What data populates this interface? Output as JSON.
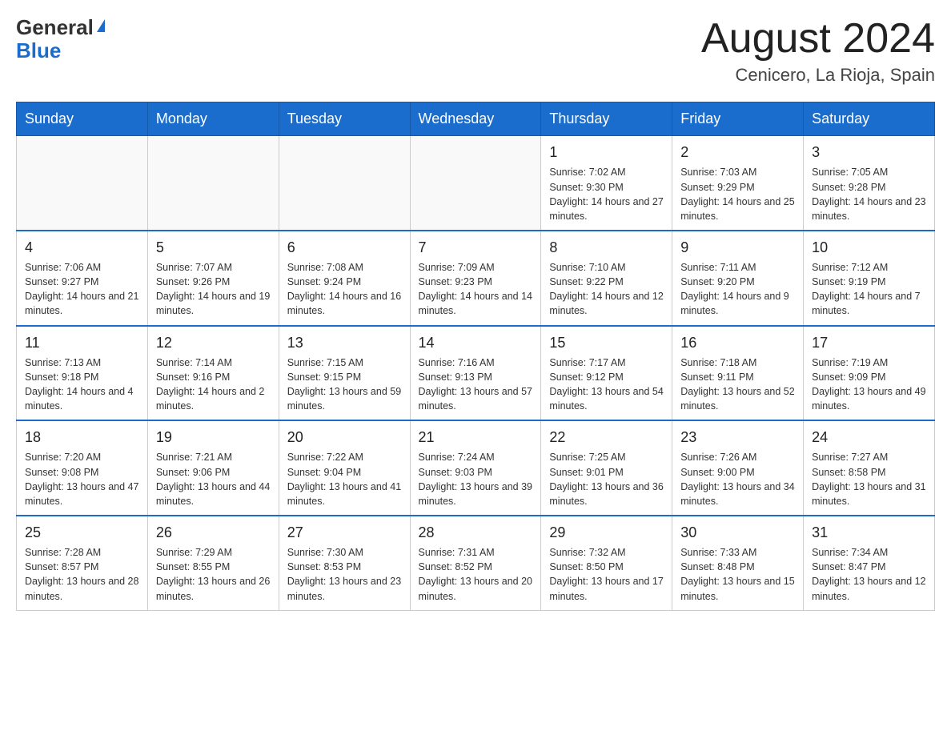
{
  "header": {
    "logo_general": "General",
    "logo_blue": "Blue",
    "month_title": "August 2024",
    "location": "Cenicero, La Rioja, Spain"
  },
  "days_of_week": [
    "Sunday",
    "Monday",
    "Tuesday",
    "Wednesday",
    "Thursday",
    "Friday",
    "Saturday"
  ],
  "weeks": [
    [
      {
        "day": "",
        "info": ""
      },
      {
        "day": "",
        "info": ""
      },
      {
        "day": "",
        "info": ""
      },
      {
        "day": "",
        "info": ""
      },
      {
        "day": "1",
        "info": "Sunrise: 7:02 AM\nSunset: 9:30 PM\nDaylight: 14 hours and 27 minutes."
      },
      {
        "day": "2",
        "info": "Sunrise: 7:03 AM\nSunset: 9:29 PM\nDaylight: 14 hours and 25 minutes."
      },
      {
        "day": "3",
        "info": "Sunrise: 7:05 AM\nSunset: 9:28 PM\nDaylight: 14 hours and 23 minutes."
      }
    ],
    [
      {
        "day": "4",
        "info": "Sunrise: 7:06 AM\nSunset: 9:27 PM\nDaylight: 14 hours and 21 minutes."
      },
      {
        "day": "5",
        "info": "Sunrise: 7:07 AM\nSunset: 9:26 PM\nDaylight: 14 hours and 19 minutes."
      },
      {
        "day": "6",
        "info": "Sunrise: 7:08 AM\nSunset: 9:24 PM\nDaylight: 14 hours and 16 minutes."
      },
      {
        "day": "7",
        "info": "Sunrise: 7:09 AM\nSunset: 9:23 PM\nDaylight: 14 hours and 14 minutes."
      },
      {
        "day": "8",
        "info": "Sunrise: 7:10 AM\nSunset: 9:22 PM\nDaylight: 14 hours and 12 minutes."
      },
      {
        "day": "9",
        "info": "Sunrise: 7:11 AM\nSunset: 9:20 PM\nDaylight: 14 hours and 9 minutes."
      },
      {
        "day": "10",
        "info": "Sunrise: 7:12 AM\nSunset: 9:19 PM\nDaylight: 14 hours and 7 minutes."
      }
    ],
    [
      {
        "day": "11",
        "info": "Sunrise: 7:13 AM\nSunset: 9:18 PM\nDaylight: 14 hours and 4 minutes."
      },
      {
        "day": "12",
        "info": "Sunrise: 7:14 AM\nSunset: 9:16 PM\nDaylight: 14 hours and 2 minutes."
      },
      {
        "day": "13",
        "info": "Sunrise: 7:15 AM\nSunset: 9:15 PM\nDaylight: 13 hours and 59 minutes."
      },
      {
        "day": "14",
        "info": "Sunrise: 7:16 AM\nSunset: 9:13 PM\nDaylight: 13 hours and 57 minutes."
      },
      {
        "day": "15",
        "info": "Sunrise: 7:17 AM\nSunset: 9:12 PM\nDaylight: 13 hours and 54 minutes."
      },
      {
        "day": "16",
        "info": "Sunrise: 7:18 AM\nSunset: 9:11 PM\nDaylight: 13 hours and 52 minutes."
      },
      {
        "day": "17",
        "info": "Sunrise: 7:19 AM\nSunset: 9:09 PM\nDaylight: 13 hours and 49 minutes."
      }
    ],
    [
      {
        "day": "18",
        "info": "Sunrise: 7:20 AM\nSunset: 9:08 PM\nDaylight: 13 hours and 47 minutes."
      },
      {
        "day": "19",
        "info": "Sunrise: 7:21 AM\nSunset: 9:06 PM\nDaylight: 13 hours and 44 minutes."
      },
      {
        "day": "20",
        "info": "Sunrise: 7:22 AM\nSunset: 9:04 PM\nDaylight: 13 hours and 41 minutes."
      },
      {
        "day": "21",
        "info": "Sunrise: 7:24 AM\nSunset: 9:03 PM\nDaylight: 13 hours and 39 minutes."
      },
      {
        "day": "22",
        "info": "Sunrise: 7:25 AM\nSunset: 9:01 PM\nDaylight: 13 hours and 36 minutes."
      },
      {
        "day": "23",
        "info": "Sunrise: 7:26 AM\nSunset: 9:00 PM\nDaylight: 13 hours and 34 minutes."
      },
      {
        "day": "24",
        "info": "Sunrise: 7:27 AM\nSunset: 8:58 PM\nDaylight: 13 hours and 31 minutes."
      }
    ],
    [
      {
        "day": "25",
        "info": "Sunrise: 7:28 AM\nSunset: 8:57 PM\nDaylight: 13 hours and 28 minutes."
      },
      {
        "day": "26",
        "info": "Sunrise: 7:29 AM\nSunset: 8:55 PM\nDaylight: 13 hours and 26 minutes."
      },
      {
        "day": "27",
        "info": "Sunrise: 7:30 AM\nSunset: 8:53 PM\nDaylight: 13 hours and 23 minutes."
      },
      {
        "day": "28",
        "info": "Sunrise: 7:31 AM\nSunset: 8:52 PM\nDaylight: 13 hours and 20 minutes."
      },
      {
        "day": "29",
        "info": "Sunrise: 7:32 AM\nSunset: 8:50 PM\nDaylight: 13 hours and 17 minutes."
      },
      {
        "day": "30",
        "info": "Sunrise: 7:33 AM\nSunset: 8:48 PM\nDaylight: 13 hours and 15 minutes."
      },
      {
        "day": "31",
        "info": "Sunrise: 7:34 AM\nSunset: 8:47 PM\nDaylight: 13 hours and 12 minutes."
      }
    ]
  ]
}
